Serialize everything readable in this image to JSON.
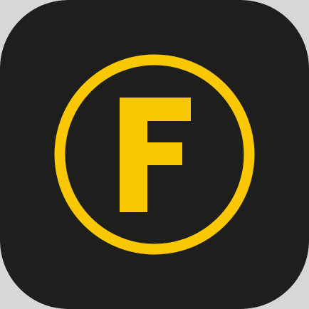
{
  "app_icon": {
    "logo_letter": "F",
    "icon_names": [
      "circle-f-logo-icon"
    ],
    "colors": {
      "tile_background": "#1e1e1c",
      "accent_yellow": "#f9c803",
      "surround": "#d6d7d9"
    }
  }
}
